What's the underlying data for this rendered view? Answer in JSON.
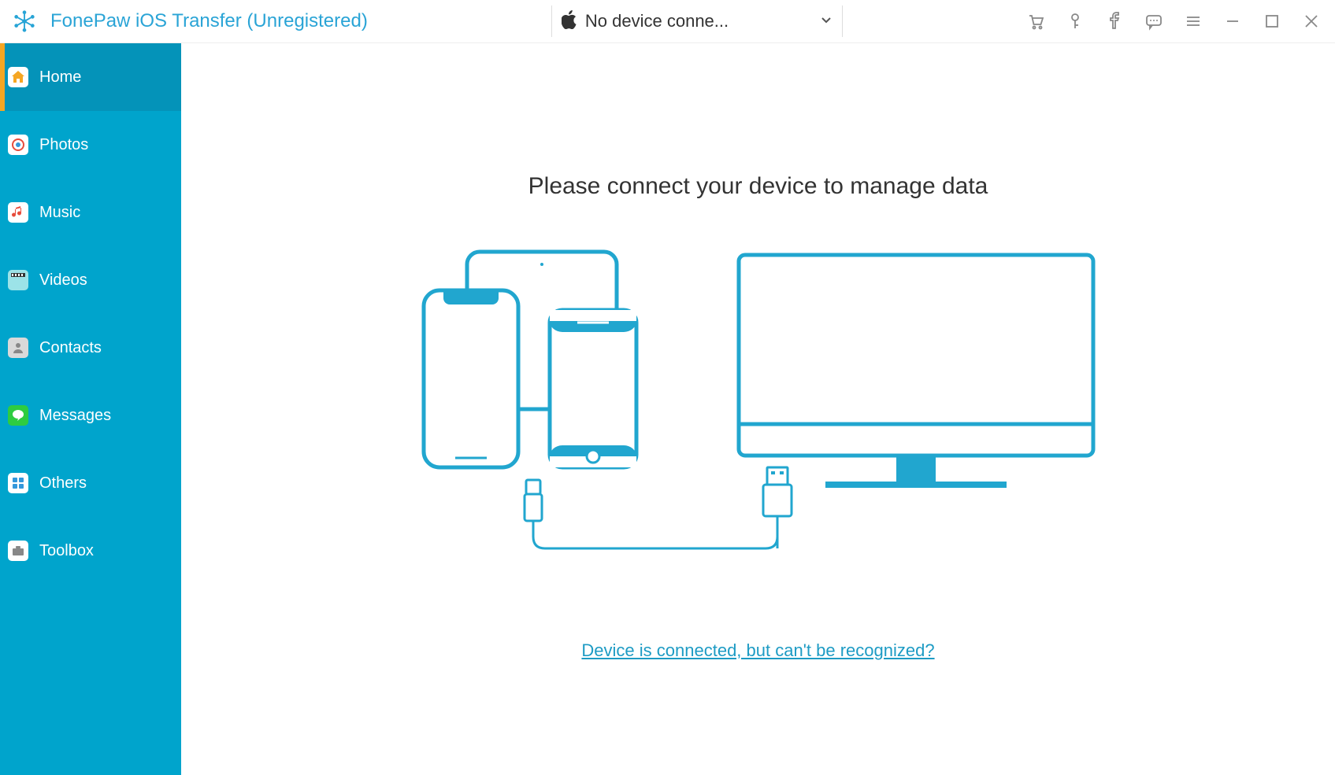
{
  "app": {
    "title": "FonePaw iOS Transfer (Unregistered)"
  },
  "device_selector": {
    "label": "No device conne..."
  },
  "sidebar": {
    "items": [
      {
        "label": "Home",
        "active": true
      },
      {
        "label": "Photos",
        "active": false
      },
      {
        "label": "Music",
        "active": false
      },
      {
        "label": "Videos",
        "active": false
      },
      {
        "label": "Contacts",
        "active": false
      },
      {
        "label": "Messages",
        "active": false
      },
      {
        "label": "Others",
        "active": false
      },
      {
        "label": "Toolbox",
        "active": false
      }
    ]
  },
  "main": {
    "headline": "Please connect your device to manage data",
    "help_link": "Device is connected, but can't be recognized?"
  }
}
